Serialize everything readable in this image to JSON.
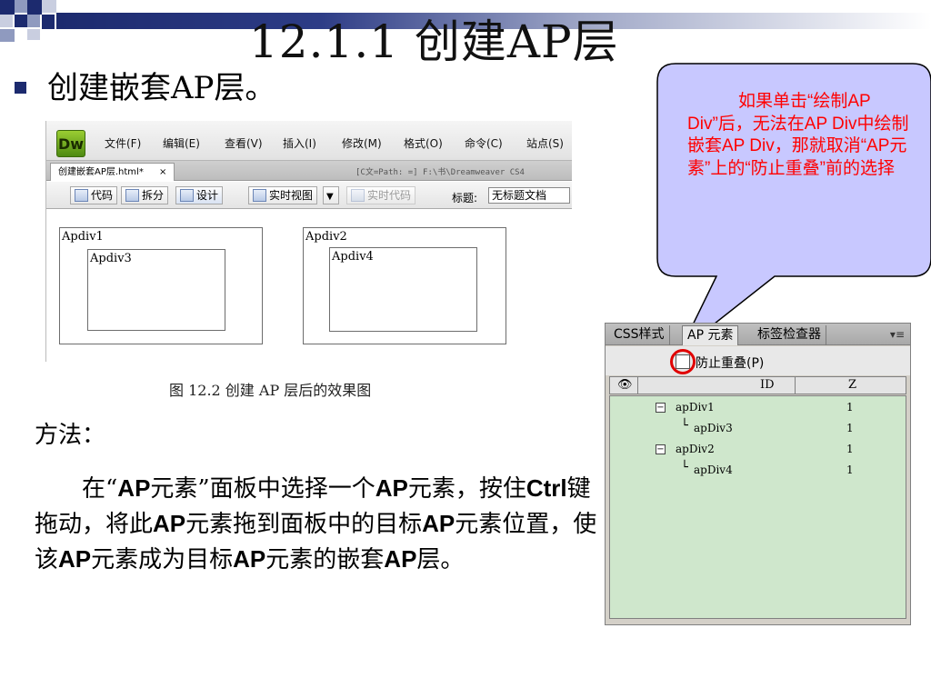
{
  "slide": {
    "title": "12.1.1  创建AP层",
    "bullet": "创建嵌套AP层。",
    "caption": "图 12.2  创建 AP 层后的效果图",
    "method_heading": "方法：",
    "method_text": "在“AP元素”面板中选择一个AP元素，按住Ctrl键拖动，将此AP元素拖到面板中的目标AP元素位置，使该AP元素成为目标AP元素的嵌套AP层。"
  },
  "callout": {
    "text": "如果单击“绘制AP Div”后，无法在AP Div中绘制嵌套AP Div，那就取消“AP元素”上的“防止重叠”前的选择",
    "fill": "#c8c8ff",
    "text_color": "#ff0000"
  },
  "dreamweaver": {
    "logo": "Dw",
    "menus": [
      "文件(F)",
      "编辑(E)",
      "查看(V)",
      "插入(I)",
      "修改(M)",
      "格式(O)",
      "命令(C)",
      "站点(S)"
    ],
    "doc_tab": "创建嵌套AP层.html*",
    "doc_tab_close": "×",
    "path": "[C文=Path: =] F:\\书\\Dreamweaver CS4",
    "toolbar": {
      "code": "代码",
      "split": "拆分",
      "design": "设计",
      "live_view": "实时视图",
      "live_code": "实时代码",
      "title_label": "标题:",
      "title_value": "无标题文档"
    },
    "boxes": {
      "apdiv1": "Apdiv1",
      "apdiv3": "Apdiv3",
      "apdiv2": "Apdiv2",
      "apdiv4": "Apdiv4"
    }
  },
  "ap_panel": {
    "tabs": [
      "CSS样式",
      "AP 元素",
      "标签检查器"
    ],
    "menu_icon": "▾≡",
    "prevent_overlap": "防止重叠(P)",
    "col_eye": "eye-icon",
    "col_id": "ID",
    "col_z": "Z",
    "rows": [
      {
        "toggle": "−",
        "name": "apDiv1",
        "z": "1"
      },
      {
        "branch": "└",
        "name": "apDiv3",
        "z": "1"
      },
      {
        "toggle": "−",
        "name": "apDiv2",
        "z": "1"
      },
      {
        "branch": "└",
        "name": "apDiv4",
        "z": "1"
      }
    ]
  },
  "colors": {
    "accent": "#1c2a6e",
    "panel_list": "#cfe7cc",
    "highlight_ring": "#e00000"
  }
}
